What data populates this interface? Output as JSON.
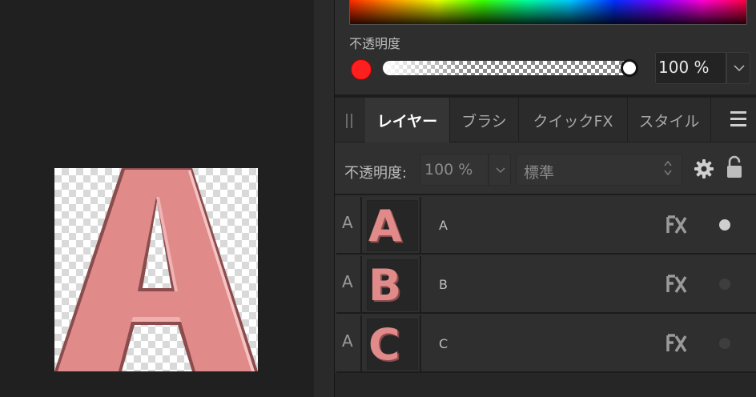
{
  "color_panel": {
    "opacity_label": "不透明度",
    "opacity_value": "100 %",
    "current_color": "#ff1f1f",
    "opacity_fraction": 1.0
  },
  "tabs": [
    {
      "label": "レイヤー",
      "active": true
    },
    {
      "label": "ブラシ",
      "active": false
    },
    {
      "label": "クイックFX",
      "active": false
    },
    {
      "label": "スタイル",
      "active": false
    }
  ],
  "layer_options": {
    "opacity_label": "不透明度:",
    "opacity_value": "100 %",
    "blend_mode": "標準"
  },
  "layers": [
    {
      "type": "A",
      "thumb_letter": "A",
      "name": "A",
      "visible": true
    },
    {
      "type": "A",
      "thumb_letter": "B",
      "name": "B",
      "visible": false
    },
    {
      "type": "A",
      "thumb_letter": "C",
      "name": "C",
      "visible": false
    }
  ],
  "icons": {
    "grip": "grip-icon",
    "menu": "hamburger-menu-icon",
    "gear": "gear-icon",
    "lock": "lock-icon",
    "fx": "fx-icon"
  },
  "colors": {
    "letter_fill": "#e08a8a",
    "letter_shadow": "#8a4c4c",
    "letter_highlight": "#f6c3c3"
  }
}
